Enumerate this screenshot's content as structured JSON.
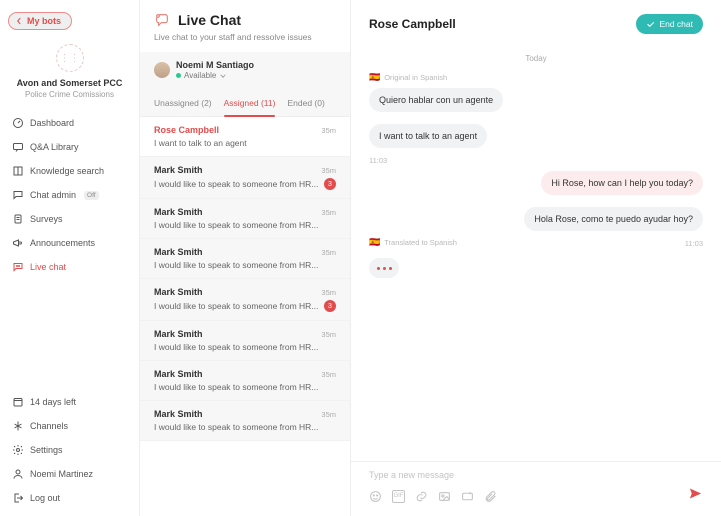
{
  "sidebar": {
    "mybots_label": "My bots",
    "org": {
      "name": "Avon and Somerset PCC",
      "sub": "Police Crime Comissions",
      "logo_glyph": "⋮⋮"
    },
    "items": [
      {
        "label": "Dashboard"
      },
      {
        "label": "Q&A Library"
      },
      {
        "label": "Knowledge search"
      },
      {
        "label": "Chat admin",
        "badge": "Off"
      },
      {
        "label": "Surveys"
      },
      {
        "label": "Announcements"
      },
      {
        "label": "Live chat"
      }
    ],
    "bottom": [
      {
        "label": "14 days left"
      },
      {
        "label": "Channels"
      },
      {
        "label": "Settings"
      },
      {
        "label": "Noemi Martinez"
      },
      {
        "label": "Log out"
      }
    ]
  },
  "convcol": {
    "title": "Live Chat",
    "sub": "Live chat to your staff and ressolve issues",
    "agent": {
      "name": "Noemi M Santiago",
      "status": "Available"
    },
    "tabs": {
      "unassigned": "Unassigned (2)",
      "assigned": "Assigned (11)",
      "ended": "Ended (0)"
    },
    "items": [
      {
        "name": "Rose Campbell",
        "time": "35m",
        "preview": "I want to talk to an agent",
        "selected": true,
        "badge": null
      },
      {
        "name": "Mark Smith",
        "time": "35m",
        "preview": "I would like to speak to someone from HR...",
        "badge": "3"
      },
      {
        "name": "Mark Smith",
        "time": "35m",
        "preview": "I would like to speak to someone from HR...",
        "badge": null
      },
      {
        "name": "Mark Smith",
        "time": "35m",
        "preview": "I would like to speak to someone from HR...",
        "badge": null
      },
      {
        "name": "Mark Smith",
        "time": "35m",
        "preview": "I would like to speak to someone from HR...",
        "badge": "3"
      },
      {
        "name": "Mark Smith",
        "time": "35m",
        "preview": "I would like to speak to someone from HR...",
        "badge": null
      },
      {
        "name": "Mark Smith",
        "time": "35m",
        "preview": "I would like to speak to someone from HR...",
        "badge": null
      },
      {
        "name": "Mark Smith",
        "time": "35m",
        "preview": "I would like to speak to someone from HR...",
        "badge": null
      }
    ]
  },
  "chat": {
    "title": "Rose Campbell",
    "end_label": "End chat",
    "day": "Today",
    "original_label": "Original in Spanish",
    "translated_label": "Translated to Spanish",
    "msgs": {
      "m1": "Quiero hablar con un agente",
      "m2": "I want to talk to an agent",
      "t_left": "11:03",
      "m3": "Hi Rose, how can I help you today?",
      "m4": "Hola Rose, como te puedo ayudar hoy?",
      "t_right": "11:03"
    },
    "flag": "🇪🇸",
    "composer_placeholder": "Type a new message",
    "gif": "GIF"
  }
}
